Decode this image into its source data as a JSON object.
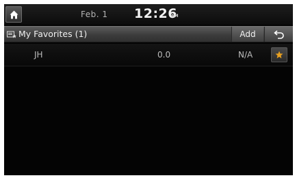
{
  "status": {
    "date": "Feb. 1",
    "time": "12:26",
    "ampm": "AM"
  },
  "header": {
    "title": "My Favorites (1)",
    "add_label": "Add",
    "title_icon": "favorites-list-icon",
    "back_icon": "back-arrow-icon",
    "home_icon": "home-icon"
  },
  "favorites": [
    {
      "name": "JH",
      "frequency": "0.0",
      "status": "N/A",
      "icon": "star-icon"
    }
  ],
  "colors": {
    "star": "#e8a020",
    "background": "#040404"
  }
}
